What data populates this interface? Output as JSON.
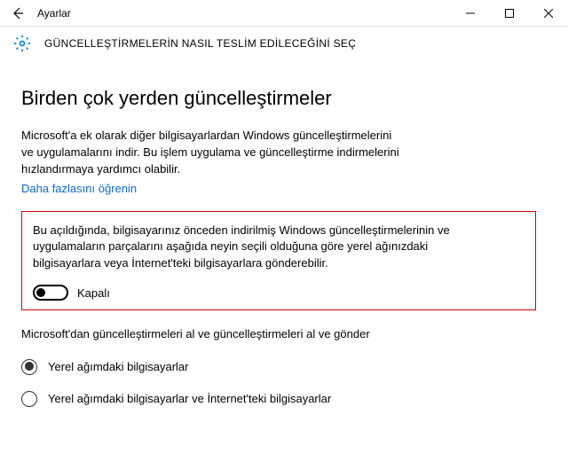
{
  "titlebar": {
    "app_name": "Ayarlar"
  },
  "subheader": {
    "heading": "GÜNCELLEŞTİRMELERİN NASIL TESLİM EDİLECEĞİNİ SEÇ"
  },
  "main": {
    "heading": "Birden çok yerden güncelleştirmeler",
    "intro": "Microsoft'a ek olarak diğer bilgisayarlardan Windows güncelleştirmelerini ve uygulamalarını indir. Bu işlem uygulama ve güncelleştirme indirmelerini hızlandırmaya yardımcı olabilir.",
    "learn_more": "Daha fazlasını öğrenin",
    "highlighted": {
      "text": "Bu açıldığında, bilgisayarınız önceden indirilmiş Windows güncelleştirmelerinin ve uygulamaların parçalarını aşağıda neyin seçili olduğuna göre yerel ağınızdaki bilgisayarlara veya İnternet'teki bilgisayarlara gönderebilir.",
      "toggle_state": "off",
      "toggle_label": "Kapalı"
    },
    "section2_text": "Microsoft'dan güncelleştirmeleri al ve güncelleştirmeleri al ve gönder",
    "radio_options": [
      {
        "label": "Yerel ağımdaki bilgisayarlar",
        "selected": true
      },
      {
        "label": "Yerel ağımdaki bilgisayarlar ve İnternet'teki bilgisayarlar",
        "selected": false
      }
    ]
  }
}
